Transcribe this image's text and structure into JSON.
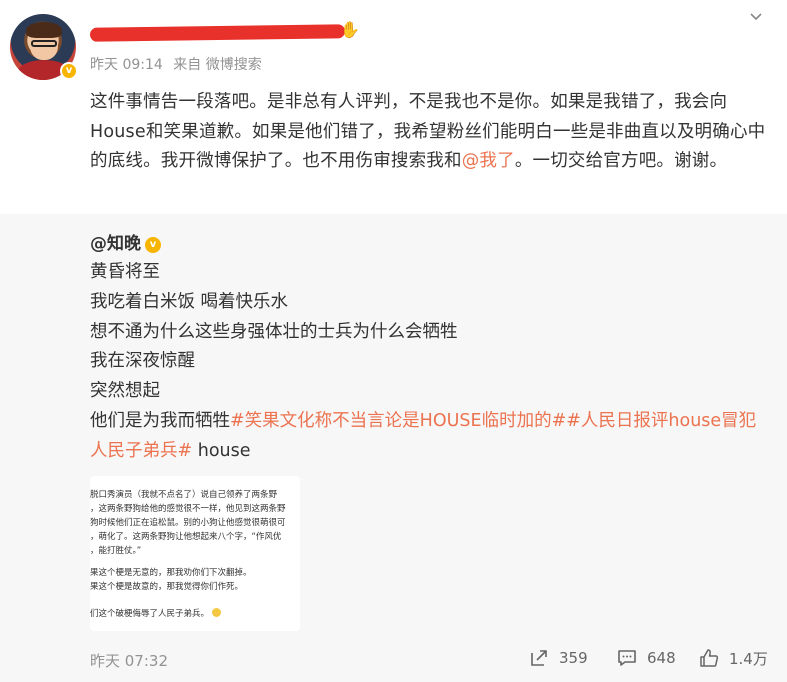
{
  "post": {
    "time": "昨天 09:14",
    "source_prefix": "来自",
    "source": "微博搜索",
    "text_parts": [
      "这件事情告一段落吧。是非总有人评判，不是我也不是你。如果是我错了，我会向House和笑果道歉。如果是他们错了，我希望粉丝们能明白一些是非曲直以及明确心中的底线。我开微博保护了。也不用伤审搜索我和",
      "@我了",
      "。一切交给官方吧。谢谢。"
    ]
  },
  "repost": {
    "author": "@知晚",
    "lines": [
      "黄昏将至",
      "我吃着白米饭 喝着快乐水",
      "想不通为什么这些身强体壮的士兵为什么会牺牲",
      "我在深夜惊醒",
      "突然想起"
    ],
    "last_line_prefix": "他们是为我而牺牲",
    "hashtag1": "#笑果文化称不当言论是HOUSE临时加的#",
    "hashtag2": "#人民日报评house冒犯人民子弟兵#",
    "last_line_suffix": " house",
    "image_lines": [
      "脱口秀演员（我就不点名了）说自己领养了两条野",
      "，这两条野狗给他的感觉很不一样，他见到这两条野",
      "狗时候他们正在追松鼠。别的小狗让他感觉很萌很可",
      "，萌化了。这两条野狗让他想起来八个字，“作风优",
      "，能打胜仗。”",
      "",
      "果这个梗是无意的，那我劝你们下次翻掉。",
      "果这个梗是故意的，那我觉得你们作死。",
      "",
      "们这个破梗侮辱了人民子弟兵。"
    ],
    "time": "昨天 07:32",
    "reposts": "359",
    "comments": "648",
    "likes": "1.4万"
  },
  "colors": {
    "link": "#eb7350",
    "meta": "#939393",
    "repost_bg": "#f7f7f7",
    "verified": "#f7b500"
  }
}
